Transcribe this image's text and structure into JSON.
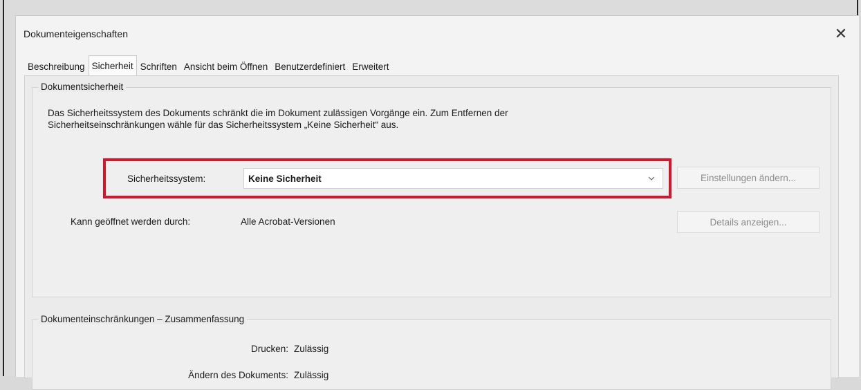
{
  "dialog": {
    "title": "Dokumenteigenschaften",
    "close_symbol": "✕"
  },
  "tabs": [
    {
      "label": "Beschreibung",
      "active": false
    },
    {
      "label": "Sicherheit",
      "active": true
    },
    {
      "label": "Schriften",
      "active": false
    },
    {
      "label": "Ansicht beim Öffnen",
      "active": false
    },
    {
      "label": "Benutzerdefiniert",
      "active": false
    },
    {
      "label": "Erweitert",
      "active": false
    }
  ],
  "security": {
    "legend": "Dokumentsicherheit",
    "description": "Das Sicherheitssystem des Dokuments schränkt die im Dokument zulässigen Vorgänge ein. Zum Entfernen der Sicherheitseinschränkungen wähle für das Sicherheitssystem „Keine Sicherheit“ aus.",
    "system_label": "Sicherheitssystem:",
    "system_value": "Keine Sicherheit",
    "settings_button": "Einstellungen ändern...",
    "open_label": "Kann geöffnet werden durch:",
    "open_value": "Alle Acrobat-Versionen",
    "details_button": "Details anzeigen...",
    "highlight_color": "#d6142c"
  },
  "restrictions": {
    "legend": "Dokumenteinschränkungen – Zusammenfassung",
    "rows": [
      {
        "label": "Drucken:",
        "value": "Zulässig"
      },
      {
        "label": "Ändern des Dokuments:",
        "value": "Zulässig"
      }
    ]
  }
}
